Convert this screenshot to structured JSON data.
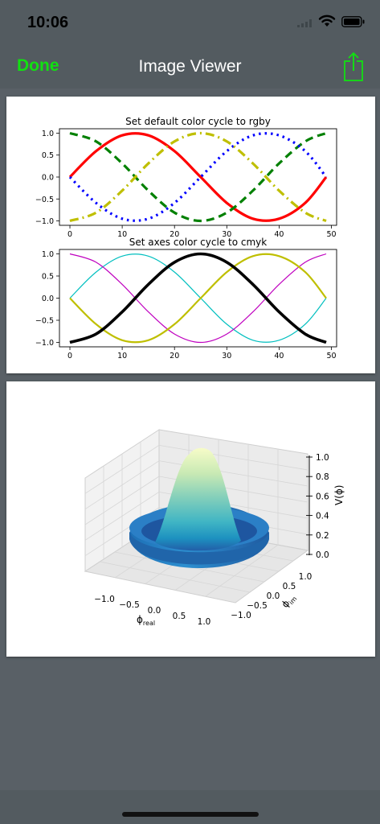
{
  "status": {
    "time": "10:06"
  },
  "nav": {
    "done_label": "Done",
    "title": "Image Viewer"
  },
  "colors": {
    "accent": "#12e012",
    "nav_bg": "#535b60",
    "page_bg": "#596066"
  },
  "figure1": {
    "chart_data": [
      {
        "type": "line",
        "title": "Set default color cycle to rgby",
        "xlim": [
          -2,
          51
        ],
        "ylim": [
          -1.1,
          1.1
        ],
        "xticks": [
          "0",
          "10",
          "20",
          "30",
          "40",
          "50"
        ],
        "yticks": [
          "1.0",
          "0.5",
          "0.0",
          "−0.5",
          "−1.0"
        ],
        "x": [
          0,
          5,
          10,
          15,
          20,
          25,
          30,
          35,
          40,
          45,
          49
        ],
        "series": [
          {
            "color": "#ff0000",
            "style": "solid",
            "values": [
              0.0,
              0.59,
              0.95,
              0.95,
              0.59,
              0.0,
              -0.59,
              -0.95,
              -0.95,
              -0.59,
              0.0
            ]
          },
          {
            "color": "#008000",
            "style": "dashed",
            "values": [
              1.0,
              0.81,
              0.31,
              -0.31,
              -0.81,
              -1.0,
              -0.81,
              -0.31,
              0.31,
              0.81,
              1.0
            ]
          },
          {
            "color": "#0000ff",
            "style": "dotted",
            "values": [
              0.0,
              -0.59,
              -0.95,
              -0.95,
              -0.59,
              0.0,
              0.59,
              0.95,
              0.95,
              0.59,
              0.0
            ]
          },
          {
            "color": "#bfbf00",
            "style": "dashdot",
            "values": [
              -1.0,
              -0.81,
              -0.31,
              0.31,
              0.81,
              1.0,
              0.81,
              0.31,
              -0.31,
              -0.81,
              -1.0
            ]
          }
        ]
      },
      {
        "type": "line",
        "title": "Set axes color cycle to cmyk",
        "xlim": [
          -2,
          51
        ],
        "ylim": [
          -1.1,
          1.1
        ],
        "xticks": [
          "0",
          "10",
          "20",
          "30",
          "40",
          "50"
        ],
        "yticks": [
          "1.0",
          "0.5",
          "0.0",
          "−0.5",
          "−1.0"
        ],
        "x": [
          0,
          5,
          10,
          15,
          20,
          25,
          30,
          35,
          40,
          45,
          49
        ],
        "series": [
          {
            "color": "#00bfbf",
            "style": "solid",
            "values": [
              0.0,
              0.59,
              0.95,
              0.95,
              0.59,
              0.0,
              -0.59,
              -0.95,
              -0.95,
              -0.59,
              0.0
            ]
          },
          {
            "color": "#bf00bf",
            "style": "solid",
            "values": [
              1.0,
              0.81,
              0.31,
              -0.31,
              -0.81,
              -1.0,
              -0.81,
              -0.31,
              0.31,
              0.81,
              1.0
            ]
          },
          {
            "color": "#bfbf00",
            "style": "solid",
            "values": [
              0.0,
              -0.59,
              -0.95,
              -0.95,
              -0.59,
              0.0,
              0.59,
              0.95,
              0.95,
              0.59,
              0.0
            ]
          },
          {
            "color": "#000000",
            "style": "solid",
            "values": [
              -1.0,
              -0.81,
              -0.31,
              0.31,
              0.81,
              1.0,
              0.81,
              0.31,
              -0.31,
              -0.81,
              -1.0
            ]
          }
        ]
      }
    ]
  },
  "figure2": {
    "type": "surface-3d",
    "zlabel": "V(ϕ)",
    "xlabel_main": "ϕ",
    "xlabel_sub": "real",
    "ylabel_main": "ϕ",
    "ylabel_sub": "im",
    "zticks": [
      "1.0",
      "0.8",
      "0.6",
      "0.4",
      "0.2",
      "0.0"
    ],
    "xticks": [
      "−1.0",
      "−0.5",
      "0.0",
      "0.5",
      "1.0"
    ],
    "yticks": [
      "1.0",
      "0.5",
      "0.0",
      "−0.5",
      "−1.0"
    ],
    "colormap": [
      "#f7fcc8",
      "#c8e9b4",
      "#7ecdbb",
      "#40b5c4",
      "#1d91c0",
      "#225ea8",
      "#253494"
    ]
  }
}
